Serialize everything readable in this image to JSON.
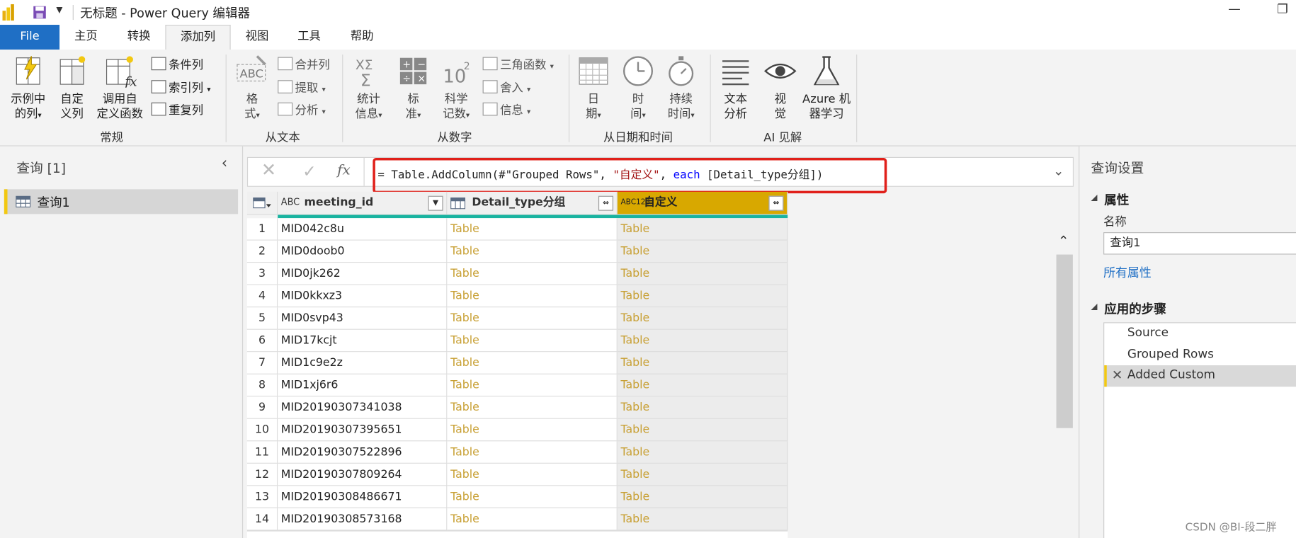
{
  "window": {
    "title": "无标题 - Power Query 编辑器",
    "minimize_glyph": "—",
    "restore_glyph": "❐"
  },
  "tabs": [
    "File",
    "主页",
    "转换",
    "添加列",
    "视图",
    "工具",
    "帮助"
  ],
  "active_tab": "添加列",
  "ribbon": {
    "general": {
      "example_column": [
        "示例中",
        "的列"
      ],
      "custom_column": [
        "自定",
        "义列"
      ],
      "invoke_function": [
        "调用自",
        "定义函数"
      ],
      "conditional_column": "条件列",
      "index_column": "索引列",
      "duplicate_column": "重复列",
      "group_label": "常规"
    },
    "from_text": {
      "format": [
        "格",
        "式"
      ],
      "merge_columns": "合并列",
      "extract": "提取",
      "parse": "分析",
      "group_label": "从文本"
    },
    "from_number": {
      "statistics": [
        "统计",
        "信息"
      ],
      "standard": [
        "标",
        "准"
      ],
      "scientific": [
        "科学",
        "记数"
      ],
      "trigonometry": "三角函数",
      "rounding": "舍入",
      "information": "信息",
      "group_label": "从数字"
    },
    "from_datetime": {
      "date": [
        "日",
        "期"
      ],
      "time": [
        "时",
        "间"
      ],
      "duration": [
        "持续",
        "时间"
      ],
      "group_label": "从日期和时间"
    },
    "ai": {
      "text_analytics": [
        "文本",
        "分析"
      ],
      "vision": [
        "视",
        "觉"
      ],
      "azure_ml": [
        "Azure 机",
        "器学习"
      ],
      "group_label": "AI 见解"
    }
  },
  "queries_pane": {
    "title": "查询 [1]",
    "items": [
      "查询1"
    ]
  },
  "formula_bar": {
    "prefix": "= Table.AddColumn(#\"Grouped Rows\", ",
    "string_arg": "\"自定义\"",
    "comma": ", ",
    "keyword": "each",
    "suffix": " [Detail_type分组])"
  },
  "grid": {
    "columns": [
      {
        "type_icon": "ABC",
        "name": "meeting_id"
      },
      {
        "type_icon": "table",
        "name": "Detail_type分组"
      },
      {
        "type_icon": "ABC123",
        "name": "自定义"
      }
    ],
    "rows": [
      {
        "n": "1",
        "meeting_id": "MID042c8u",
        "detail": "Table",
        "custom": "Table"
      },
      {
        "n": "2",
        "meeting_id": "MID0doob0",
        "detail": "Table",
        "custom": "Table"
      },
      {
        "n": "3",
        "meeting_id": "MID0jk262",
        "detail": "Table",
        "custom": "Table"
      },
      {
        "n": "4",
        "meeting_id": "MID0kkxz3",
        "detail": "Table",
        "custom": "Table"
      },
      {
        "n": "5",
        "meeting_id": "MID0svp43",
        "detail": "Table",
        "custom": "Table"
      },
      {
        "n": "6",
        "meeting_id": "MID17kcjt",
        "detail": "Table",
        "custom": "Table"
      },
      {
        "n": "7",
        "meeting_id": "MID1c9e2z",
        "detail": "Table",
        "custom": "Table"
      },
      {
        "n": "8",
        "meeting_id": "MID1xj6r6",
        "detail": "Table",
        "custom": "Table"
      },
      {
        "n": "9",
        "meeting_id": "MID20190307341038",
        "detail": "Table",
        "custom": "Table"
      },
      {
        "n": "10",
        "meeting_id": "MID20190307395651",
        "detail": "Table",
        "custom": "Table"
      },
      {
        "n": "11",
        "meeting_id": "MID20190307522896",
        "detail": "Table",
        "custom": "Table"
      },
      {
        "n": "12",
        "meeting_id": "MID20190307809264",
        "detail": "Table",
        "custom": "Table"
      },
      {
        "n": "13",
        "meeting_id": "MID20190308486671",
        "detail": "Table",
        "custom": "Table"
      },
      {
        "n": "14",
        "meeting_id": "MID20190308573168",
        "detail": "Table",
        "custom": "Table"
      }
    ]
  },
  "query_settings": {
    "title": "查询设置",
    "properties_header": "属性",
    "name_label": "名称",
    "name_value": "查询1",
    "all_properties_link": "所有属性",
    "steps_header": "应用的步骤",
    "steps": [
      "Source",
      "Grouped Rows",
      "Added Custom"
    ],
    "selected_step": "Added Custom"
  },
  "watermark": "CSDN @BI-段二胖",
  "colors": {
    "file_tab": "#1f6fc5",
    "table_link": "#c8a034",
    "custom_header": "#d8a800",
    "quality_bar": "#19b3a0",
    "highlight_border": "#e0201a",
    "string_literal": "#a31515",
    "keyword": "#0000ff",
    "link": "#1f6fc5",
    "query_accent": "#f2c811"
  }
}
